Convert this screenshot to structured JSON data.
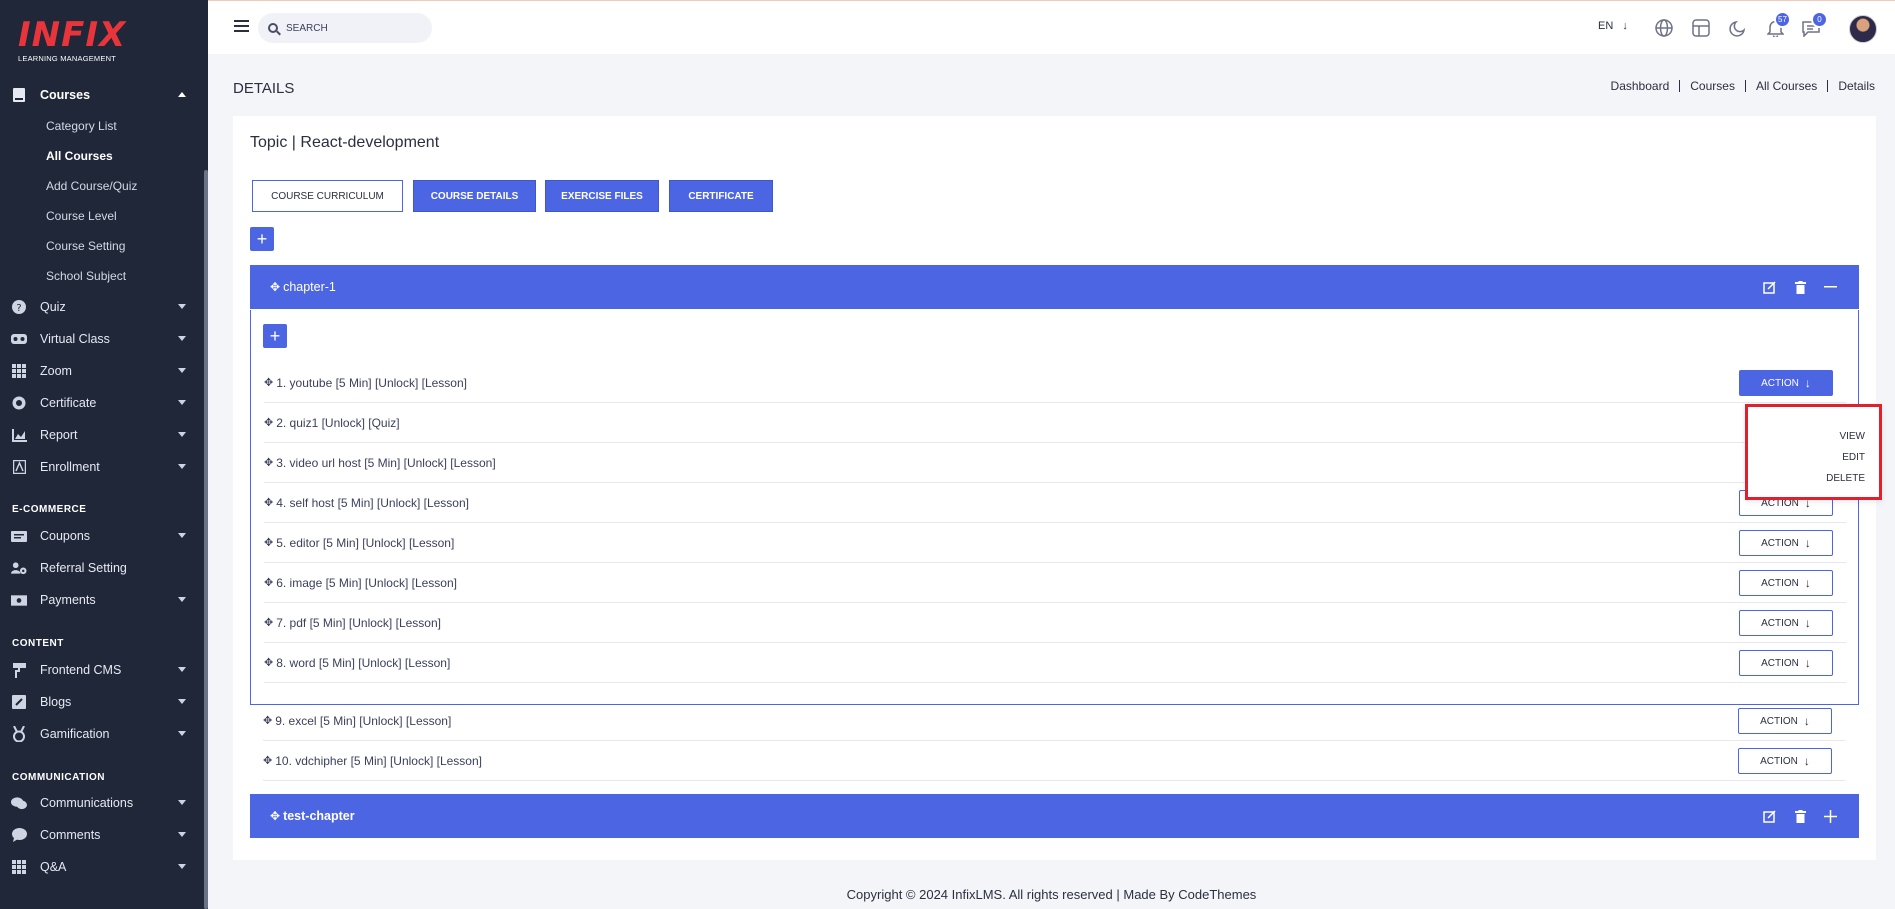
{
  "logo": {
    "main": "INFIX",
    "sub": "LEARNING MANAGEMENT"
  },
  "sidebar": {
    "courses": {
      "label": "Courses",
      "sub": [
        "Category List",
        "All Courses",
        "Add Course/Quiz",
        "Course Level",
        "Course Setting",
        "School Subject"
      ]
    },
    "items_main": [
      "Quiz",
      "Virtual Class",
      "Zoom",
      "Certificate",
      "Report",
      "Enrollment"
    ],
    "sections": {
      "ecommerce": "E-COMMERCE",
      "content": "CONTENT",
      "communication": "COMMUNICATION"
    },
    "items_ecommerce": [
      "Coupons",
      "Referral Setting",
      "Payments"
    ],
    "items_content": [
      "Frontend CMS",
      "Blogs",
      "Gamification"
    ],
    "items_communication": [
      "Communications",
      "Comments",
      "Q&A"
    ]
  },
  "topbar": {
    "search_placeholder": "SEARCH",
    "lang": "EN",
    "notifications_count": "57",
    "messages_count": "0"
  },
  "page": {
    "title": "DETAILS",
    "breadcrumb": [
      "Dashboard",
      "Courses",
      "All Courses",
      "Details"
    ],
    "card_title": "Topic | React-development",
    "tabs": [
      "COURSE CURRICULUM",
      "COURSE DETAILS",
      "EXERCISE FILES",
      "CERTIFICATE"
    ]
  },
  "chapters": [
    {
      "title": "chapter-1"
    },
    {
      "title": "test-chapter"
    }
  ],
  "lessons": [
    "1. youtube [5 Min] [Unlock] [Lesson]",
    "2. quiz1 [Unlock] [Quiz]",
    "3. video url host [5 Min] [Unlock] [Lesson]",
    "4. self host [5 Min] [Unlock] [Lesson]",
    "5. editor [5 Min] [Unlock] [Lesson]",
    "6. image [5 Min] [Unlock] [Lesson]",
    "7. pdf [5 Min] [Unlock] [Lesson]",
    "8. word [5 Min] [Unlock] [Lesson]",
    "9. excel [5 Min] [Unlock] [Lesson]",
    "10. vdchipher [5 Min] [Unlock] [Lesson]"
  ],
  "action_label": "ACTION",
  "dropdown": [
    "VIEW",
    "EDIT",
    "DELETE"
  ],
  "footer": "Copyright © 2024 InfixLMS. All rights reserved | Made By CodeThemes",
  "colors": {
    "primary": "#4c65e2",
    "sidebar_bg": "#1f2738",
    "logo": "#e8353b",
    "highlight": "#e0202c"
  }
}
